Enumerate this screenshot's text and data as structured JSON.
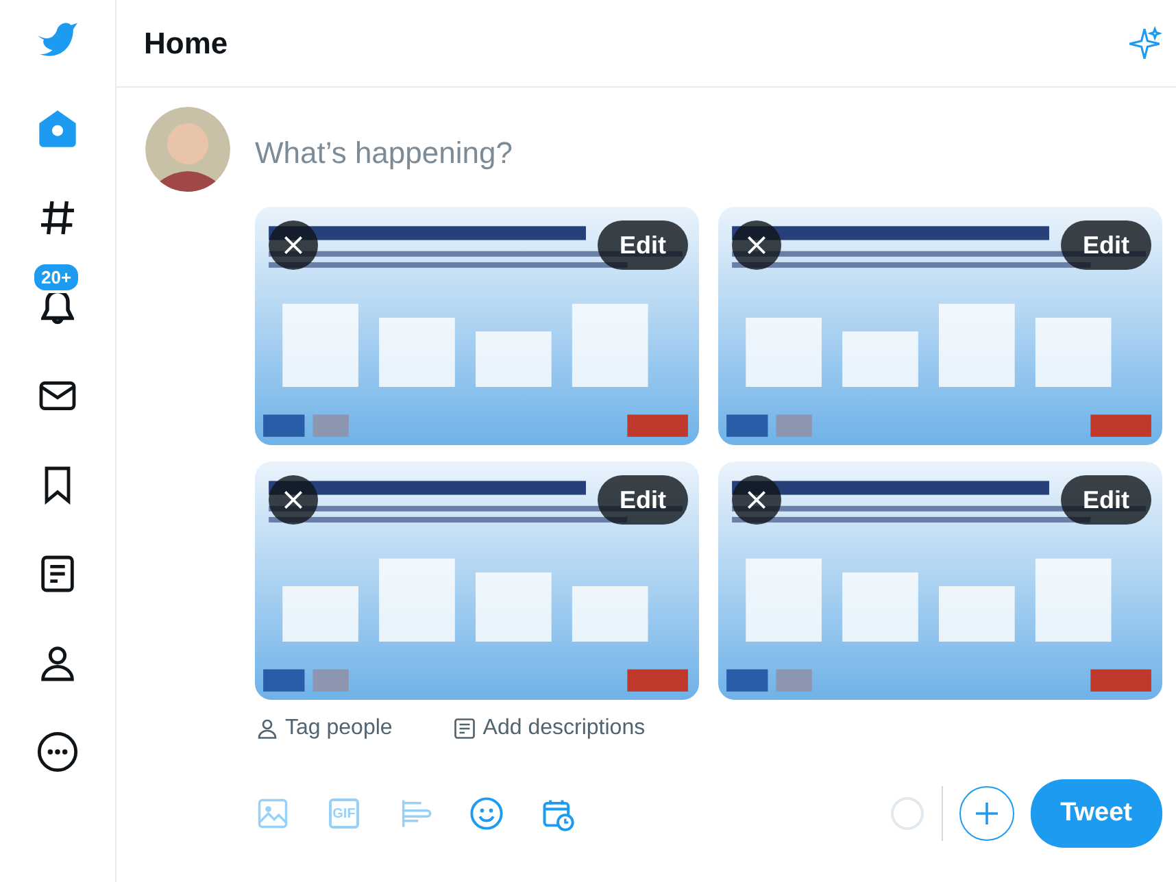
{
  "sidebar": {
    "items": [
      {
        "selected": true
      },
      {
        "selected": false
      },
      {
        "selected": false,
        "badge": "20+"
      },
      {
        "selected": false
      },
      {
        "selected": false
      },
      {
        "selected": false
      },
      {
        "selected": false
      },
      {
        "selected": false
      }
    ]
  },
  "header": {
    "title": "Home"
  },
  "composer": {
    "placeholder": "What’s happening?",
    "attachments": [
      {
        "kind": "picture",
        "edit": "Edit"
      },
      {
        "kind": "picture",
        "edit": "Edit"
      },
      {
        "kind": "picture",
        "edit": "Edit"
      },
      {
        "kind": "picture",
        "edit": "Edit"
      }
    ],
    "tag_people": "Tag people",
    "add_descriptions": "Add descriptions",
    "tools": [
      {
        "disabled": true
      },
      {
        "disabled": true,
        "label": "GIF"
      },
      {
        "disabled": true
      },
      {
        "disabled": false
      },
      {
        "disabled": false
      }
    ],
    "tweet_button": "Tweet"
  }
}
